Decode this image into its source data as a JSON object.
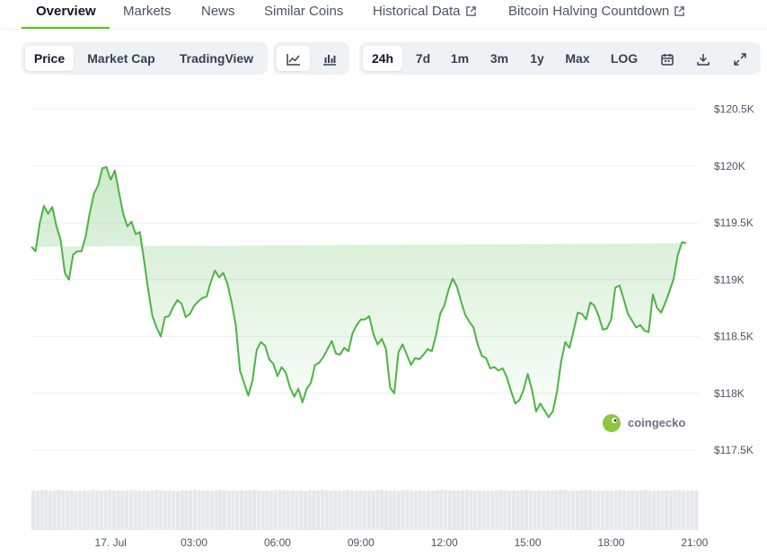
{
  "tabs": [
    {
      "label": "Overview"
    },
    {
      "label": "Markets"
    },
    {
      "label": "News"
    },
    {
      "label": "Similar Coins"
    },
    {
      "label": "Historical Data"
    },
    {
      "label": "Bitcoin Halving Countdown"
    }
  ],
  "chart_toggle": [
    "Price",
    "Market Cap",
    "TradingView"
  ],
  "ranges": [
    "24h",
    "7d",
    "1m",
    "3m",
    "1y",
    "Max",
    "LOG"
  ],
  "selected": {
    "metric": "Price",
    "range": "24h",
    "view": "line"
  },
  "icons": [
    "line-chart-icon",
    "candlestick-icon",
    "calendar-icon",
    "download-icon",
    "expand-icon",
    "external-link-icon"
  ],
  "colors": {
    "line": "#4bb543",
    "accent": "#4bcc00",
    "watermark": "#8dc63f"
  },
  "watermark": "coingecko",
  "chart_data": {
    "type": "area",
    "title": "",
    "xlabel": "",
    "ylabel": "",
    "ylim": [
      117350,
      120600
    ],
    "y_ticks": [
      117500,
      118000,
      118500,
      119000,
      119500,
      120000,
      120500
    ],
    "y_tick_labels": [
      "$117.5K",
      "$118K",
      "$118.5K",
      "$119K",
      "$119.5K",
      "$120K",
      "$120.5K"
    ],
    "x_range_hours": [
      -2.85,
      21.15
    ],
    "x_ticks_hours": [
      0,
      3,
      6,
      9,
      12,
      15,
      18,
      21
    ],
    "x_tick_labels": [
      "17. Jul",
      "03:00",
      "06:00",
      "09:00",
      "12:00",
      "15:00",
      "18:00",
      "21:00"
    ],
    "grid": true,
    "x_hours": [
      -2.85,
      -2.7,
      -2.55,
      -2.4,
      -2.25,
      -2.1,
      -1.95,
      -1.8,
      -1.65,
      -1.5,
      -1.35,
      -1.2,
      -1.05,
      -0.9,
      -0.75,
      -0.6,
      -0.45,
      -0.3,
      -0.15,
      0,
      0.15,
      0.3,
      0.45,
      0.6,
      0.75,
      0.9,
      1.05,
      1.2,
      1.35,
      1.5,
      1.65,
      1.8,
      1.95,
      2.1,
      2.25,
      2.4,
      2.55,
      2.7,
      2.85,
      3,
      3.15,
      3.3,
      3.45,
      3.6,
      3.75,
      3.9,
      4.05,
      4.2,
      4.35,
      4.5,
      4.65,
      4.8,
      4.95,
      5.1,
      5.25,
      5.4,
      5.55,
      5.7,
      5.85,
      6,
      6.15,
      6.3,
      6.45,
      6.6,
      6.75,
      6.9,
      7.05,
      7.2,
      7.35,
      7.5,
      7.65,
      7.8,
      7.95,
      8.1,
      8.25,
      8.4,
      8.55,
      8.7,
      8.85,
      9,
      9.15,
      9.3,
      9.45,
      9.6,
      9.75,
      9.9,
      10.05,
      10.2,
      10.35,
      10.5,
      10.65,
      10.8,
      10.95,
      11.1,
      11.25,
      11.4,
      11.55,
      11.7,
      11.85,
      12,
      12.15,
      12.3,
      12.45,
      12.6,
      12.75,
      12.9,
      13.05,
      13.2,
      13.35,
      13.5,
      13.65,
      13.8,
      13.95,
      14.1,
      14.25,
      14.4,
      14.55,
      14.7,
      14.85,
      15,
      15.15,
      15.3,
      15.45,
      15.6,
      15.75,
      15.9,
      16.05,
      16.2,
      16.35,
      16.5,
      16.65,
      16.8,
      16.95,
      17.1,
      17.25,
      17.4,
      17.55,
      17.7,
      17.85,
      18,
      18.15,
      18.3,
      18.45,
      18.6,
      18.75,
      18.9,
      19.05,
      19.2,
      19.35,
      19.5,
      19.65,
      19.8,
      19.95,
      20.1,
      20.25,
      20.4,
      20.55,
      20.7,
      20.85,
      21.0
    ],
    "series": [
      {
        "values": [
          119290,
          119250,
          119500,
          119650,
          119580,
          119640,
          119470,
          119350,
          119060,
          119000,
          119220,
          119250,
          119250,
          119380,
          119590,
          119760,
          119830,
          119980,
          119990,
          119880,
          119960,
          119770,
          119580,
          119470,
          119510,
          119400,
          119420,
          119170,
          118910,
          118680,
          118580,
          118500,
          118670,
          118680,
          118760,
          118820,
          118790,
          118670,
          118700,
          118770,
          118810,
          118840,
          118850,
          118980,
          119080,
          119020,
          119060,
          118960,
          118800,
          118600,
          118200,
          118090,
          117980,
          118110,
          118380,
          118450,
          118420,
          118300,
          118260,
          118150,
          118230,
          118180,
          118050,
          117970,
          118040,
          117920,
          118040,
          118090,
          118250,
          118270,
          118320,
          118390,
          118460,
          118350,
          118340,
          118400,
          118370,
          118530,
          118600,
          118650,
          118650,
          118680,
          118520,
          118430,
          118480,
          118390,
          118050,
          118000,
          118360,
          118430,
          118340,
          118250,
          118310,
          118300,
          118340,
          118390,
          118370,
          118510,
          118700,
          118770,
          118910,
          119010,
          118940,
          118810,
          118690,
          118630,
          118580,
          118430,
          118330,
          118310,
          118220,
          118230,
          118200,
          118220,
          118140,
          118020,
          117910,
          117940,
          118030,
          118170,
          118030,
          117840,
          117910,
          117850,
          117790,
          117840,
          118010,
          118280,
          118450,
          118400,
          118550,
          118710,
          118700,
          118650,
          118800,
          118770,
          118680,
          118560,
          118570,
          118650,
          118930,
          118950,
          118830,
          118700,
          118640,
          118580,
          118600,
          118550,
          118540,
          118870,
          118750,
          118710,
          118800,
          118900,
          119010,
          119220,
          119330,
          119320
        ]
      }
    ],
    "volume_relative": [
      0.94,
      0.93,
      0.95,
      0.94,
      0.93,
      0.94,
      0.95,
      0.94,
      0.93,
      0.94,
      0.92,
      0.93,
      0.94,
      0.93,
      0.95,
      0.94,
      0.93,
      0.94,
      0.95,
      0.93,
      0.94,
      0.93,
      0.94,
      0.95,
      0.94,
      0.93,
      0.94,
      0.93,
      0.94,
      0.95,
      0.94,
      0.93,
      0.94,
      0.93,
      0.92,
      0.94,
      0.93,
      0.94,
      0.95,
      0.94,
      0.93,
      0.94,
      0.93,
      0.94,
      0.95,
      0.94,
      0.93,
      0.94,
      0.93,
      0.94,
      0.93,
      0.94,
      0.95,
      0.94,
      0.93,
      0.94,
      0.93,
      0.94,
      0.95,
      0.94,
      0.93,
      0.94,
      0.93,
      0.94,
      0.92,
      0.94,
      0.93,
      0.94,
      0.95,
      0.94,
      0.93,
      0.94,
      0.93,
      0.94,
      0.95,
      0.94,
      0.93,
      0.94,
      0.93,
      0.94,
      0.93,
      0.94,
      0.95,
      0.94,
      0.93,
      0.94,
      0.93,
      0.94,
      0.95,
      0.94,
      0.93,
      0.94,
      0.93,
      0.94,
      0.93,
      0.94,
      0.95,
      0.94,
      0.93,
      0.94,
      0.93,
      0.94,
      0.95,
      0.94,
      0.93,
      0.94,
      0.93,
      0.94,
      0.93,
      0.94,
      0.95,
      0.94,
      0.93,
      0.94,
      0.93,
      0.94,
      0.95,
      0.94,
      0.93,
      0.94,
      0.93,
      0.94,
      0.93,
      0.94,
      0.95,
      0.94,
      0.93,
      0.94,
      0.93,
      0.94,
      0.95,
      0.94,
      0.93,
      0.94,
      0.93,
      0.94,
      0.93,
      0.94,
      0.95,
      0.94,
      0.93,
      0.94,
      0.93,
      0.94,
      0.95,
      0.94,
      0.93,
      0.94,
      0.93,
      0.94,
      0.93,
      0.94,
      0.95,
      0.94,
      0.93,
      0.94,
      0.93
    ]
  }
}
